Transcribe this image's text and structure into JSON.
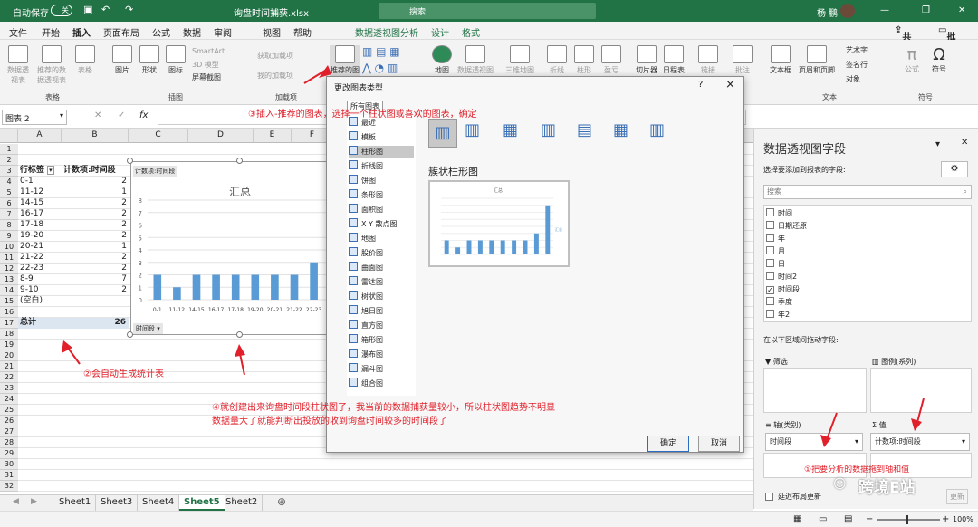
{
  "titlebar": {
    "autosave_label": "自动保存",
    "autosave_state": "关",
    "file_name": "询盘时间捕获.xlsx",
    "search_placeholder": "搜索",
    "user_name": "杨 鹏"
  },
  "menu": {
    "items": [
      "文件",
      "开始",
      "插入",
      "页面布局",
      "公式",
      "数据",
      "审阅",
      "视图",
      "帮助",
      "数据透视图分析",
      "设计",
      "格式"
    ],
    "active": "插入",
    "share_label": "共享",
    "comments_label": "批注"
  },
  "ribbon": {
    "buttons": [
      "数据透视表",
      "推荐的数据透视表",
      "表格",
      "图片",
      "形状",
      "图标",
      "SmartArt",
      "3D 模型",
      "屏幕截图",
      "获取加载项",
      "我的加载项",
      "推荐的图表",
      "地图",
      "数据透视图",
      "三维地图",
      "折线",
      "柱形",
      "盈亏",
      "切片器",
      "日程表",
      "链接",
      "批注",
      "文本框",
      "页眉和页脚",
      "艺术字",
      "签名行",
      "对象",
      "公式",
      "符号"
    ],
    "groups": [
      "表格",
      "插图",
      "加载项",
      "文本",
      "符号"
    ]
  },
  "formula": {
    "name_box": "图表 2",
    "fx": "fx"
  },
  "sheet": {
    "columns": [
      "A",
      "B",
      "C",
      "D",
      "E",
      "F"
    ],
    "rows": [
      "1",
      "2",
      "3",
      "4",
      "5",
      "6",
      "7",
      "8",
      "9",
      "10",
      "11",
      "12",
      "13",
      "14",
      "15",
      "16",
      "17",
      "18",
      "19",
      "20",
      "21",
      "22",
      "23",
      "24",
      "25",
      "26",
      "27",
      "28",
      "29",
      "30",
      "31",
      "32"
    ],
    "pivot_header_label": "行标签",
    "pivot_header_value": "计数项:时间段",
    "pivot_rows": [
      {
        "label": "0-1",
        "value": "2"
      },
      {
        "label": "11-12",
        "value": "1"
      },
      {
        "label": "14-15",
        "value": "2"
      },
      {
        "label": "16-17",
        "value": "2"
      },
      {
        "label": "17-18",
        "value": "2"
      },
      {
        "label": "19-20",
        "value": "2"
      },
      {
        "label": "20-21",
        "value": "1"
      },
      {
        "label": "21-22",
        "value": "2"
      },
      {
        "label": "22-23",
        "value": "2"
      },
      {
        "label": "8-9",
        "value": "7"
      },
      {
        "label": "9-10",
        "value": "2"
      },
      {
        "label": "(空白)",
        "value": ""
      }
    ],
    "total_label": "总计",
    "total_value": "26"
  },
  "chart_data": {
    "type": "bar",
    "title": "汇总",
    "field_label": "计数项:时间段",
    "axis_button": "时间段",
    "categories": [
      "0-1",
      "11-12",
      "14-15",
      "16-17",
      "17-18",
      "19-20",
      "20-21",
      "21-22",
      "22-23",
      "8-9"
    ],
    "values": [
      2,
      1,
      2,
      2,
      2,
      2,
      2,
      2,
      3,
      7
    ],
    "ylim": [
      0,
      8
    ],
    "yticks": [
      "0",
      "1",
      "2",
      "3",
      "4",
      "5",
      "6",
      "7",
      "8"
    ],
    "bar_color": "#5b9bd5",
    "grid": true
  },
  "dialog": {
    "title": "更改图表类型",
    "help": "?",
    "close": "×",
    "tab_all": "所有图表",
    "chart_types": [
      "最近",
      "模板",
      "柱形图",
      "折线图",
      "饼图",
      "条形图",
      "面积图",
      "X Y 散点图",
      "地图",
      "股价图",
      "曲面图",
      "雷达图",
      "树状图",
      "旭日图",
      "直方图",
      "箱形图",
      "瀑布图",
      "漏斗图",
      "组合图"
    ],
    "selected_type": "柱形图",
    "subtype_title": "簇状柱形图",
    "preview_title": "汇总",
    "preview_legend": "汇总",
    "ok": "确定",
    "cancel": "取消"
  },
  "panel": {
    "title": "数据透视图字段",
    "subtitle": "选择要添加到报表的字段:",
    "search_placeholder": "搜索",
    "fields": [
      {
        "name": "时间",
        "checked": false
      },
      {
        "name": "日期还原",
        "checked": false
      },
      {
        "name": "年",
        "checked": false
      },
      {
        "name": "月",
        "checked": false
      },
      {
        "name": "日",
        "checked": false
      },
      {
        "name": "时间2",
        "checked": false
      },
      {
        "name": "时间段",
        "checked": true
      },
      {
        "name": "季度",
        "checked": false
      },
      {
        "name": "年2",
        "checked": false
      }
    ],
    "areas_label": "在以下区域间拖动字段:",
    "filter_label": "筛选",
    "legend_label": "图例(系列)",
    "axis_label": "轴(类别)",
    "values_label": "Σ 值",
    "axis_value": "时间段",
    "values_value": "计数项:时间段",
    "defer_label": "延迟布局更新",
    "update_button": "更新"
  },
  "tabs": {
    "items": [
      "Sheet1",
      "Sheet3",
      "Sheet4",
      "Sheet5",
      "Sheet2"
    ],
    "active": "Sheet5"
  },
  "status": {
    "zoom": "100%"
  },
  "annotations": {
    "step1": "①把要分析的数据拖到轴和值",
    "step2": "②会自动生成统计表",
    "step3": "③插入-推荐的图表，选择一个柱状图或喜欢的图表，确定",
    "step4_line1": "④就创建出来询盘时间段柱状图了，我当前的数据捕获量较小，所以柱状图趋势不明显",
    "step4_line2": "数据量大了就能判断出投放的收到询盘时间较多的时间段了",
    "watermark": "跨境E站"
  },
  "colors": {
    "excel_green": "#217346",
    "annotation_red": "#e0202a",
    "bar_blue": "#5b9bd5"
  }
}
